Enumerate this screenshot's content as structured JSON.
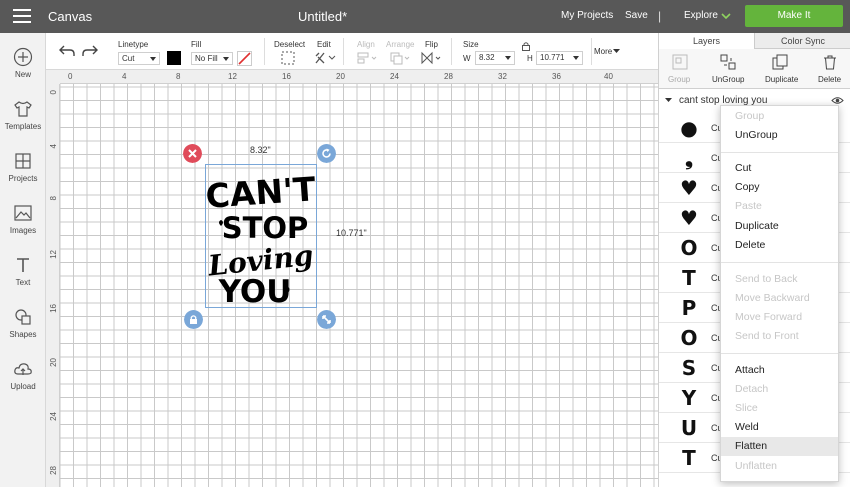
{
  "topbar": {
    "app_name": "Canvas",
    "doc_title": "Untitled*",
    "my_projects": "My Projects",
    "save": "Save",
    "divider": "|",
    "explore": "Explore",
    "make_it": "Make It"
  },
  "leftbar": {
    "items": [
      {
        "label": "New",
        "icon": "plus-circle-icon"
      },
      {
        "label": "Templates",
        "icon": "shirt-icon"
      },
      {
        "label": "Projects",
        "icon": "projects-icon"
      },
      {
        "label": "Images",
        "icon": "image-icon"
      },
      {
        "label": "Text",
        "icon": "text-icon"
      },
      {
        "label": "Shapes",
        "icon": "shapes-icon"
      },
      {
        "label": "Upload",
        "icon": "upload-cloud-icon"
      }
    ]
  },
  "toolbar": {
    "linetype_label": "Linetype",
    "linetype_value": "Cut",
    "fill_label": "Fill",
    "fill_value": "No Fill",
    "line_color": "#000000",
    "deselect": "Deselect",
    "edit": "Edit",
    "align": "Align",
    "arrange": "Arrange",
    "flip": "Flip",
    "size": "Size",
    "w_label": "W",
    "w_value": "8.32",
    "h_label": "H",
    "h_value": "10.771",
    "more": "More"
  },
  "rulers": {
    "top": [
      "0",
      "4",
      "8",
      "12",
      "16",
      "20",
      "24",
      "28",
      "32",
      "36",
      "40"
    ],
    "left": [
      "0",
      "4",
      "8",
      "12",
      "16",
      "20",
      "24",
      "28"
    ]
  },
  "canvas": {
    "width_label": "8.32\"",
    "height_label": "10.771\"",
    "design_lines": [
      "CAN'T",
      "STOP",
      "Loving",
      "YOU"
    ]
  },
  "layers_panel": {
    "tabs": [
      "Layers",
      "Color Sync"
    ],
    "actions": [
      {
        "label": "Group",
        "disabled": true
      },
      {
        "label": "UnGroup",
        "disabled": false
      },
      {
        "label": "Duplicate",
        "disabled": false
      },
      {
        "label": "Delete",
        "disabled": false
      }
    ],
    "group_name": "cant stop loving you",
    "rows": [
      {
        "glyph": "●",
        "name": "Cu"
      },
      {
        "glyph": "❟",
        "name": "Cu"
      },
      {
        "glyph": "♥",
        "name": "Cu"
      },
      {
        "glyph": "♥",
        "name": "Cu"
      },
      {
        "glyph": "O",
        "name": "Cu"
      },
      {
        "glyph": "T",
        "name": "Cu"
      },
      {
        "glyph": "P",
        "name": "Cu"
      },
      {
        "glyph": "O",
        "name": "Cu"
      },
      {
        "glyph": "S",
        "name": "Cu"
      },
      {
        "glyph": "Y",
        "name": "Cu"
      },
      {
        "glyph": "U",
        "name": "Cu"
      },
      {
        "glyph": "T",
        "name": "Cu"
      }
    ]
  },
  "context_menu": {
    "items": [
      {
        "label": "Group",
        "disabled": true
      },
      {
        "label": "UnGroup",
        "disabled": false
      },
      {
        "label": "Cut",
        "disabled": false
      },
      {
        "label": "Copy",
        "disabled": false
      },
      {
        "label": "Paste",
        "disabled": true
      },
      {
        "label": "Duplicate",
        "disabled": false
      },
      {
        "label": "Delete",
        "disabled": false
      },
      {
        "label": "Send to Back",
        "disabled": true
      },
      {
        "label": "Move Backward",
        "disabled": true
      },
      {
        "label": "Move Forward",
        "disabled": true
      },
      {
        "label": "Send to Front",
        "disabled": true
      },
      {
        "label": "Attach",
        "disabled": false
      },
      {
        "label": "Detach",
        "disabled": true
      },
      {
        "label": "Slice",
        "disabled": true
      },
      {
        "label": "Weld",
        "disabled": false
      },
      {
        "label": "Flatten",
        "disabled": false,
        "highlighted": true
      },
      {
        "label": "Unflatten",
        "disabled": true
      }
    ]
  },
  "colors": {
    "topbar": "#585858",
    "make_it": "#64b43c",
    "delete_handle": "#e04b5a",
    "handles": "#7aa7d8"
  }
}
